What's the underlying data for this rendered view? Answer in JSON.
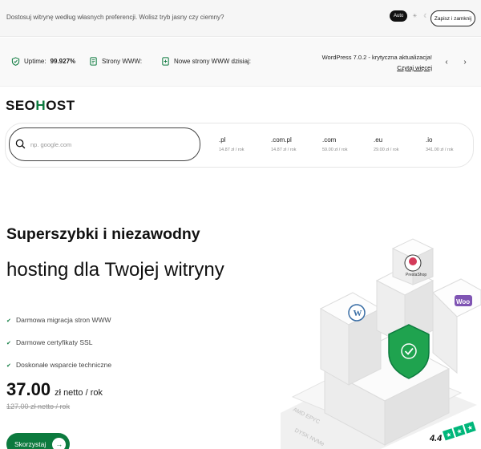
{
  "theme_bar": {
    "text": "Dostosuj witrynę według własnych preferencji. Wolisz tryb jasny czy ciemny?",
    "mode_auto": "Auto",
    "save_label": "Zapisz i zamknij"
  },
  "status": {
    "uptime_label": "Uptime:",
    "uptime_value": "99.927%",
    "sites_label": "Strony WWW:",
    "new_sites_label": "Nowe strony WWW dzisiaj:",
    "wp_title": "WordPress 7.0.2 - krytyczna aktualizacja!",
    "wp_link": "Czytaj więcej"
  },
  "logo": {
    "before": "SEO",
    "h": "H",
    "after": "OST"
  },
  "search": {
    "placeholder": "np. google.com",
    "tlds": [
      {
        "ext": ".pl",
        "price": "14.87 zł / rok"
      },
      {
        "ext": ".com.pl",
        "price": "14.87 zł / rok"
      },
      {
        "ext": ".com",
        "price": "59.00 zł / rok"
      },
      {
        "ext": ".eu",
        "price": "29.00 zł / rok"
      },
      {
        "ext": ".io",
        "price": "341.00 zł / rok"
      }
    ]
  },
  "hero": {
    "line1": "Superszybki i niezawodny",
    "line2": "hosting dla Twojej witryny",
    "features": [
      "Darmowa migracja stron WWW",
      "Darmowe certyfikaty SSL",
      "Doskonałe wsparcie techniczne"
    ],
    "price": "37.00",
    "price_unit": "zł netto / rok",
    "old_price": "127.00 zł netto / rok",
    "cta_label": "Skorzystaj"
  },
  "illustration": {
    "amd_label": "AMD EPYC",
    "disk_label": "DYSK NVMe",
    "woo_label": "Woo",
    "presta_label": "PrestaShop",
    "rating": "4.4"
  },
  "icons": {
    "check": "check-icon",
    "search": "search-icon",
    "uptime": "uptime-shield-icon",
    "sites": "document-icon",
    "new_sites": "document-add-icon"
  },
  "colors": {
    "brand_green": "#0c7a3e",
    "trustpilot_green": "#00b67a"
  }
}
